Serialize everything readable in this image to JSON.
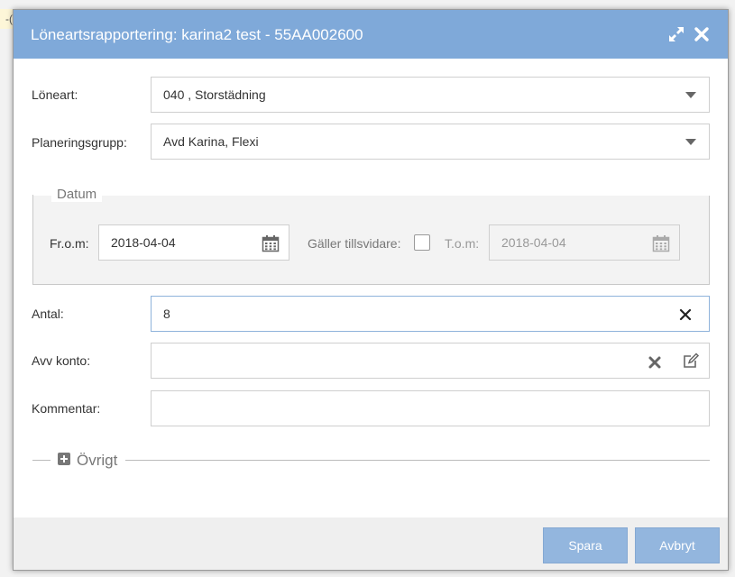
{
  "background": {
    "corner_glyph": "-("
  },
  "dialog": {
    "title": "Löneartsrapportering: karina2 test - 55AA002600",
    "expand_icon": "expand-icon",
    "close_icon": "close-icon"
  },
  "form": {
    "loneart": {
      "label": "Löneart:",
      "value": "040 , Storstädning"
    },
    "planeringsgrupp": {
      "label": "Planeringsgrupp:",
      "value": "Avd Karina, Flexi"
    },
    "datum": {
      "legend": "Datum",
      "from_label": "Fr.o.m:",
      "from_value": "2018-04-04",
      "valid_until_further_label": "Gäller tillsvidare:",
      "valid_until_further_checked": false,
      "to_label": "T.o.m:",
      "to_value": "2018-04-04"
    },
    "antal": {
      "label": "Antal:",
      "value": "8"
    },
    "avv_konto": {
      "label": "Avv konto:",
      "value": ""
    },
    "kommentar": {
      "label": "Kommentar:",
      "value": ""
    },
    "ovrigt": {
      "label": "Övrigt"
    }
  },
  "footer": {
    "save_label": "Spara",
    "cancel_label": "Avbryt"
  },
  "colors": {
    "titlebar": "#7fa9d9",
    "button": "#93b6de"
  }
}
